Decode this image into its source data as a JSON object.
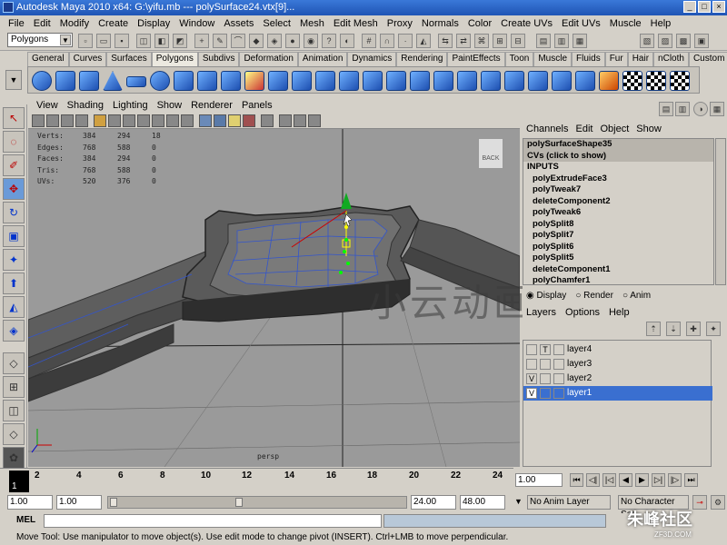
{
  "window": {
    "title": "Autodesk Maya 2010 x64: G:\\yifu.mb   ---   polySurface24.vtx[9]..."
  },
  "menubar": [
    "File",
    "Edit",
    "Modify",
    "Create",
    "Display",
    "Window",
    "Assets",
    "Select",
    "Mesh",
    "Edit Mesh",
    "Proxy",
    "Normals",
    "Color",
    "Create UVs",
    "Edit UVs",
    "Muscle",
    "Help"
  ],
  "mode_select": "Polygons",
  "shelf_tabs": [
    "General",
    "Curves",
    "Surfaces",
    "Polygons",
    "Subdivs",
    "Deformation",
    "Animation",
    "Dynamics",
    "Rendering",
    "PaintEffects",
    "Toon",
    "Muscle",
    "Fluids",
    "Fur",
    "Hair",
    "nCloth",
    "Custom"
  ],
  "shelf_active": "Polygons",
  "viewport_menu": [
    "View",
    "Shading",
    "Lighting",
    "Show",
    "Renderer",
    "Panels"
  ],
  "hud": {
    "rows": [
      {
        "label": "Verts:",
        "a": "384",
        "b": "294",
        "c": "18"
      },
      {
        "label": "Edges:",
        "a": "768",
        "b": "588",
        "c": "0"
      },
      {
        "label": "Faces:",
        "a": "384",
        "b": "294",
        "c": "0"
      },
      {
        "label": "Tris:",
        "a": "768",
        "b": "588",
        "c": "0"
      },
      {
        "label": "UVs:",
        "a": "520",
        "b": "376",
        "c": "0"
      }
    ]
  },
  "camera_label": "persp",
  "viewcube_label": "BACK",
  "watermark_cn": "小云动画",
  "channel_box": {
    "menu": [
      "Channels",
      "Edit",
      "Object",
      "Show"
    ],
    "items": [
      "polySurfaceShape35",
      "CVs (click to show)",
      "INPUTS",
      "polyExtrudeFace3",
      "polyTweak7",
      "deleteComponent2",
      "polyTweak6",
      "polySplit8",
      "polySplit7",
      "polySplit6",
      "polySplit5",
      "deleteComponent1",
      "polyChamfer1"
    ]
  },
  "layer_panel": {
    "tabs": [
      "Display",
      "Render",
      "Anim"
    ],
    "menu": [
      "Layers",
      "Options",
      "Help"
    ],
    "layers": [
      {
        "vis": "",
        "type": "T",
        "name": "layer4"
      },
      {
        "vis": "",
        "type": "",
        "name": "layer3"
      },
      {
        "vis": "V",
        "type": "",
        "name": "layer2"
      },
      {
        "vis": "V",
        "type": "",
        "name": "layer1"
      }
    ],
    "selected_layer": "layer1"
  },
  "timeline": {
    "current_frame": "1",
    "ticks": [
      "2",
      "4",
      "6",
      "8",
      "10",
      "12",
      "14",
      "16",
      "18",
      "20",
      "22",
      "24"
    ]
  },
  "playback": {
    "current_field": "1.00"
  },
  "range": {
    "start": "1.00",
    "start2": "1.00",
    "end": "24.00",
    "end2": "48.00",
    "anim_layer": "No Anim Layer",
    "character_set": "No Character Set"
  },
  "command_line": {
    "label": "MEL"
  },
  "help_line": "Move Tool: Use manipulator to move object(s). Use edit mode to change pivot (INSERT).  Ctrl+LMB to move perpendicular.",
  "watermark": {
    "brand": "朱峰社区",
    "url": "ZF3D.COM"
  }
}
